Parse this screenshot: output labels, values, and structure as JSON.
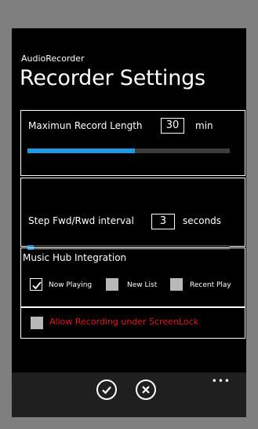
{
  "app": {
    "name": "AudioRecorder",
    "page_title": "Recorder Settings"
  },
  "record_length": {
    "label": "Maximun Record Length",
    "value": "30",
    "unit": "min",
    "slider_fraction": 0.53
  },
  "step_interval": {
    "label": "Step Fwd/Rwd interval",
    "value": "3",
    "unit": "seconds",
    "slider_fraction": 0.03
  },
  "music_hub": {
    "title": "Music Hub Integration",
    "options": [
      {
        "label": "Now Playing",
        "checked": true
      },
      {
        "label": "New List",
        "checked": false
      },
      {
        "label": "Recent Play",
        "checked": false
      }
    ]
  },
  "screen_lock": {
    "label": "Allow Recording under ScreenLock",
    "checked": false,
    "color": "#e8141b"
  },
  "app_bar": {
    "save_icon": "checkmark-icon",
    "cancel_icon": "close-icon",
    "more_label": "•••"
  },
  "colors": {
    "accent": "#1d9ae2",
    "background": "#000000"
  }
}
